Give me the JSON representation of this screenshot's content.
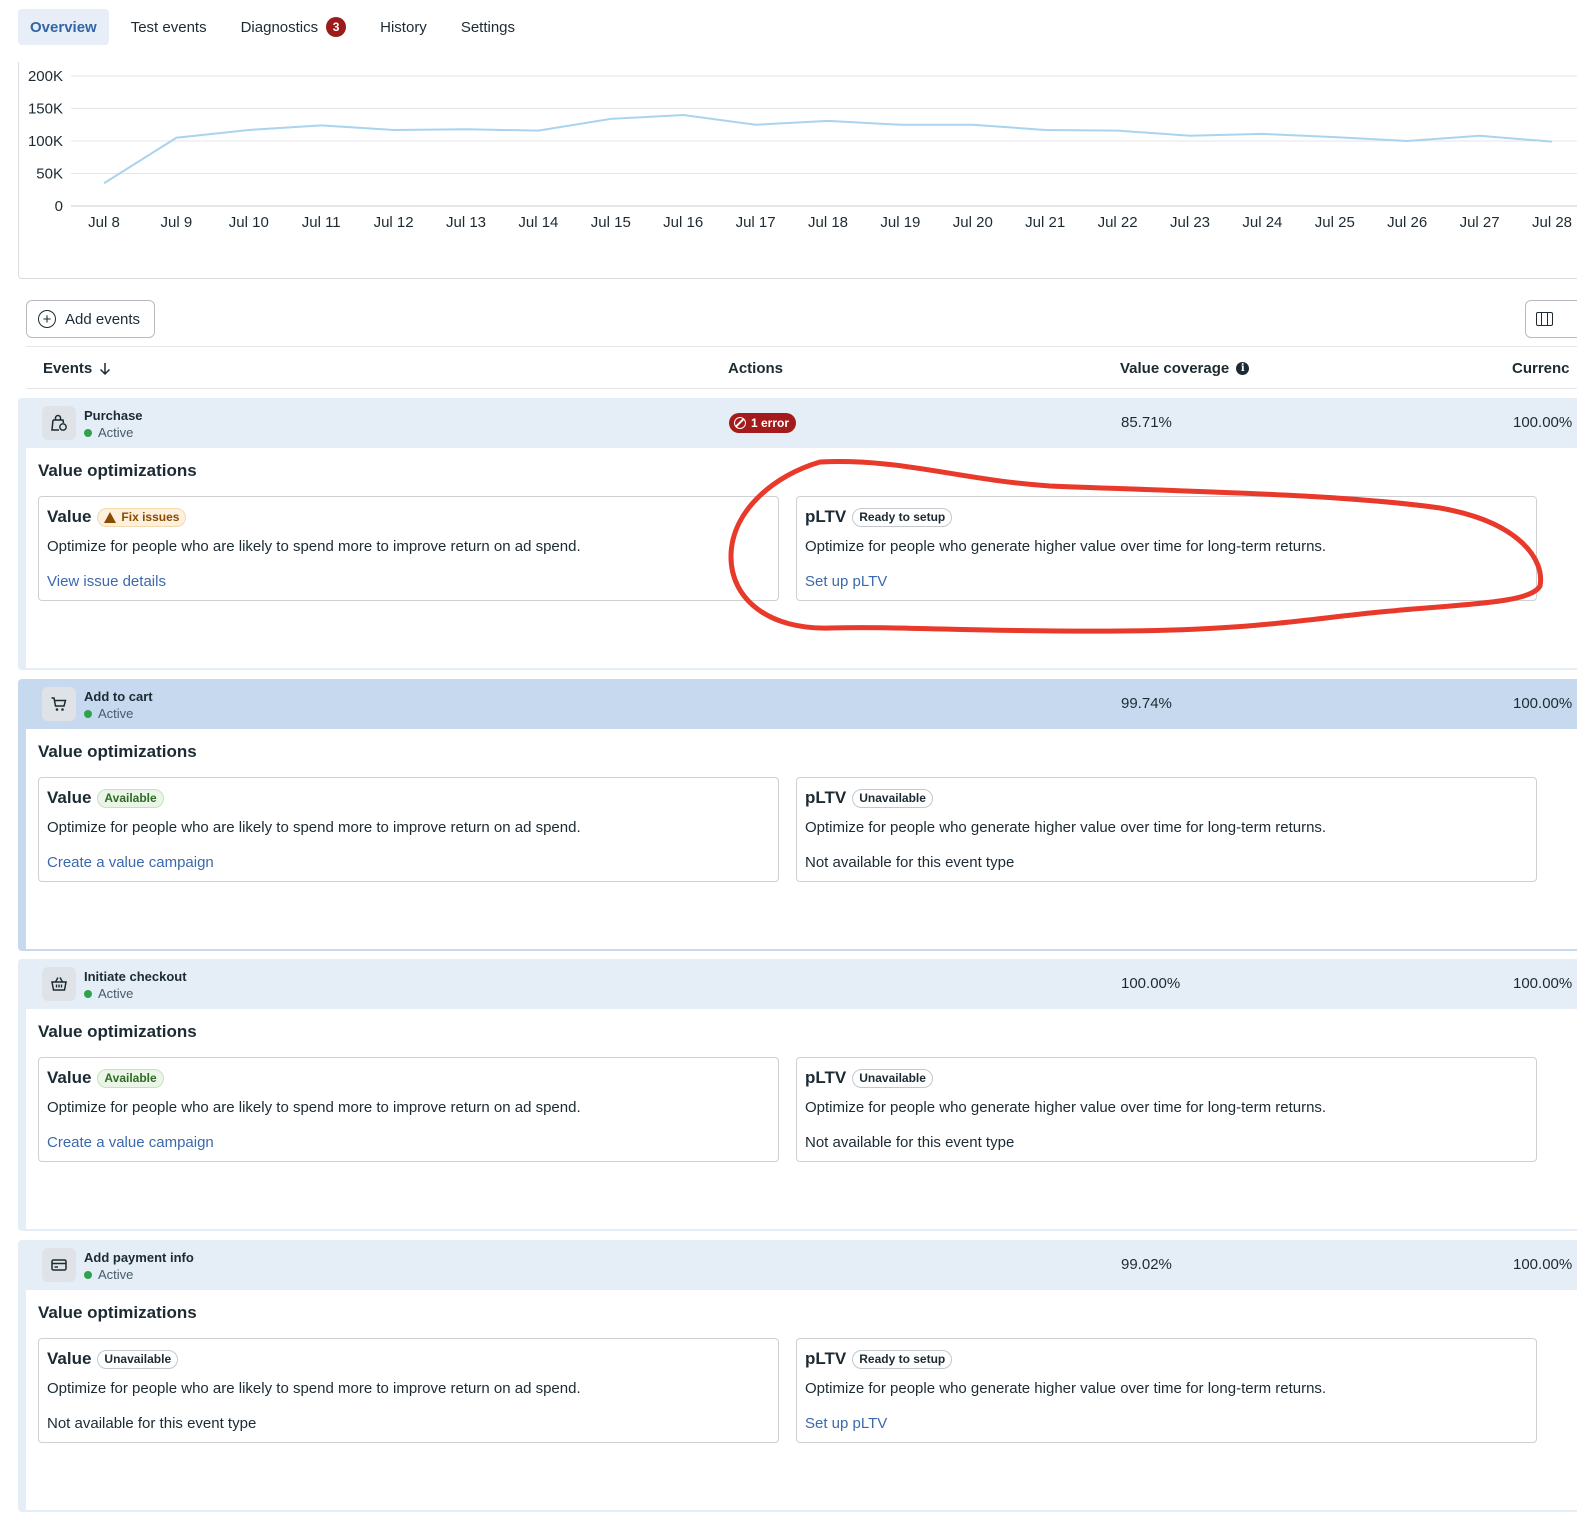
{
  "tabs": [
    {
      "label": "Overview",
      "active": true
    },
    {
      "label": "Test events"
    },
    {
      "label": "Diagnostics",
      "badge": "3"
    },
    {
      "label": "History"
    },
    {
      "label": "Settings"
    }
  ],
  "chart_data": {
    "type": "line",
    "title": "",
    "xlabel": "",
    "ylabel": "",
    "categories": [
      "Jul 8",
      "Jul 9",
      "Jul 10",
      "Jul 11",
      "Jul 12",
      "Jul 13",
      "Jul 14",
      "Jul 15",
      "Jul 16",
      "Jul 17",
      "Jul 18",
      "Jul 19",
      "Jul 20",
      "Jul 21",
      "Jul 22",
      "Jul 23",
      "Jul 24",
      "Jul 25",
      "Jul 26",
      "Jul 27",
      "Jul 28"
    ],
    "yticks": [
      "200K",
      "150K",
      "100K",
      "50K",
      "0"
    ],
    "ylim": [
      0,
      200000
    ],
    "grid": true,
    "color": "#a9d4ee",
    "series": [
      {
        "values": [
          35000,
          105000,
          117000,
          124000,
          117000,
          118000,
          116000,
          134000,
          140000,
          125000,
          131000,
          125000,
          125000,
          117000,
          116000,
          108000,
          111000,
          106000,
          100000,
          108000,
          99000
        ]
      }
    ]
  },
  "toolbar": {
    "add_events_label": "Add events"
  },
  "table": {
    "headers": {
      "events": "Events",
      "actions": "Actions",
      "coverage": "Value coverage",
      "currency": "Currenc"
    }
  },
  "events": [
    {
      "name": "Purchase",
      "status": "Active",
      "coverage": "85.71%",
      "currency": "100.00%",
      "error": "1 error",
      "section_title": "Value optimizations",
      "value": {
        "title": "Value",
        "badge": "Fix issues",
        "desc": "Optimize for people who are likely to spend more to improve return on ad spend.",
        "link": "View issue details"
      },
      "pltv": {
        "title": "pLTV",
        "badge": "Ready to setup",
        "desc": "Optimize for people who generate higher value over time for long-term returns.",
        "link": "Set up pLTV"
      }
    },
    {
      "name": "Add to cart",
      "status": "Active",
      "coverage": "99.74%",
      "currency": "100.00%",
      "section_title": "Value optimizations",
      "value": {
        "title": "Value",
        "badge": "Available",
        "desc": "Optimize for people who are likely to spend more to improve return on ad spend.",
        "link": "Create a value campaign"
      },
      "pltv": {
        "title": "pLTV",
        "badge": "Unavailable",
        "desc": "Optimize for people who generate higher value over time for long-term returns.",
        "note": "Not available for this event type"
      }
    },
    {
      "name": "Initiate checkout",
      "status": "Active",
      "coverage": "100.00%",
      "currency": "100.00%",
      "section_title": "Value optimizations",
      "value": {
        "title": "Value",
        "badge": "Available",
        "desc": "Optimize for people who are likely to spend more to improve return on ad spend.",
        "link": "Create a value campaign"
      },
      "pltv": {
        "title": "pLTV",
        "badge": "Unavailable",
        "desc": "Optimize for people who generate higher value over time for long-term returns.",
        "note": "Not available for this event type"
      }
    },
    {
      "name": "Add payment info",
      "status": "Active",
      "coverage": "99.02%",
      "currency": "100.00%",
      "section_title": "Value optimizations",
      "value": {
        "title": "Value",
        "badge": "Unavailable",
        "desc": "Optimize for people who are likely to spend more to improve return on ad spend.",
        "note": "Not available for this event type"
      },
      "pltv": {
        "title": "pLTV",
        "badge": "Ready to setup",
        "desc": "Optimize for people who generate higher value over time for long-term returns.",
        "link": "Set up pLTV"
      }
    }
  ],
  "colors": {
    "accent": "#3464a8",
    "annotation": "#e8392a",
    "error": "#a31b1b",
    "line": "#a9d4ee"
  }
}
